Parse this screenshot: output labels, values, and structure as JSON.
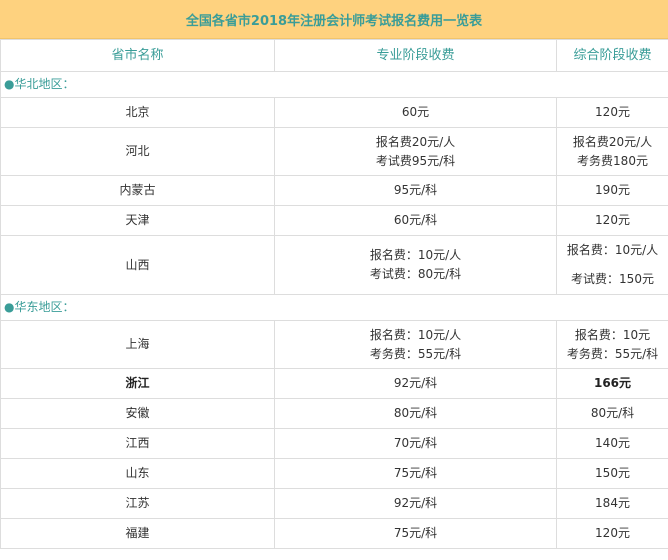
{
  "title": "全国各省市2018年注册会计师考试报名费用一览表",
  "columns": [
    "省市名称",
    "专业阶段收费",
    "综合阶段收费"
  ],
  "regions": [
    {
      "label": "●华北地区：",
      "rows": [
        {
          "province": "北京",
          "professional": [
            "60元"
          ],
          "comprehensive": [
            "120元"
          ]
        },
        {
          "province": "河北",
          "professional": [
            "报名费20元/人",
            "考试费95元/科"
          ],
          "comprehensive": [
            "报名费20元/人",
            "考务费180元"
          ]
        },
        {
          "province": "内蒙古",
          "professional": [
            "95元/科"
          ],
          "comprehensive": [
            "190元"
          ]
        },
        {
          "province": "天津",
          "professional": [
            "60元/科"
          ],
          "comprehensive": [
            "120元"
          ]
        },
        {
          "province": "山西",
          "professional": [
            "报名费：10元/人",
            "考试费：80元/科"
          ],
          "comprehensive": [
            "报名费：10元/人",
            "考试费：150元"
          ]
        }
      ]
    },
    {
      "label": "●华东地区：",
      "rows": [
        {
          "province": "上海",
          "professional": [
            "报名费：10元/人",
            "考务费：55元/科"
          ],
          "comprehensive": [
            "报名费：10元",
            "考务费：55元/科"
          ]
        },
        {
          "province": "浙江",
          "professional": [
            "92元/科"
          ],
          "comprehensive": [
            "166元"
          ],
          "bold": true
        },
        {
          "province": "安徽",
          "professional": [
            "80元/科"
          ],
          "comprehensive": [
            "80元/科"
          ]
        },
        {
          "province": "江西",
          "professional": [
            "70元/科"
          ],
          "comprehensive": [
            "140元"
          ]
        },
        {
          "province": "山东",
          "professional": [
            "75元/科"
          ],
          "comprehensive": [
            "150元"
          ]
        },
        {
          "province": "江苏",
          "professional": [
            "92元/科"
          ],
          "comprehensive": [
            "184元"
          ]
        },
        {
          "province": "福建",
          "professional": [
            "75元/科"
          ],
          "comprehensive": [
            "120元"
          ]
        }
      ]
    }
  ]
}
